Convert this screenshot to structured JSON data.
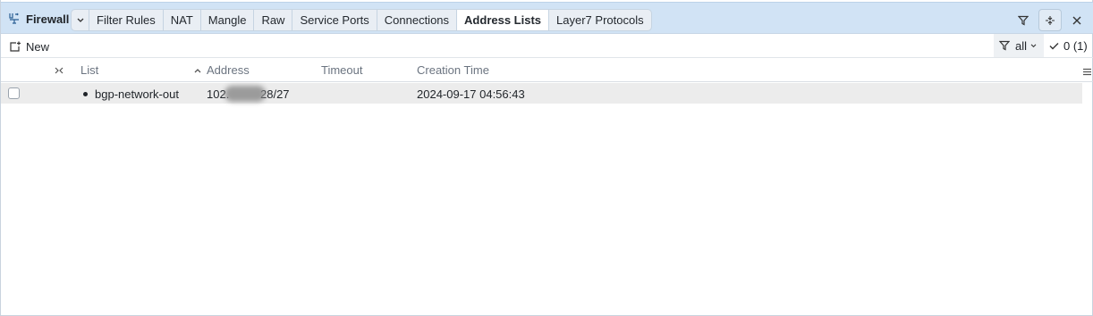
{
  "window": {
    "title": "Firewall",
    "icon": "firewall-network-icon"
  },
  "tabs": [
    {
      "label": "Filter Rules",
      "active": false
    },
    {
      "label": "NAT",
      "active": false
    },
    {
      "label": "Mangle",
      "active": false
    },
    {
      "label": "Raw",
      "active": false
    },
    {
      "label": "Service Ports",
      "active": false
    },
    {
      "label": "Connections",
      "active": false
    },
    {
      "label": "Address Lists",
      "active": true
    },
    {
      "label": "Layer7 Protocols",
      "active": false
    }
  ],
  "toolbar": {
    "new_label": "New",
    "filter_value": "all",
    "selection_count": "0 (1)"
  },
  "table": {
    "columns": [
      "List",
      "Address",
      "Timeout",
      "Creation Time"
    ],
    "sort_column": "Address",
    "rows": [
      {
        "list": "bgp-network-out",
        "address_prefix": "102.",
        "address_suffix": "28/27",
        "timeout": "",
        "creation_time": "2024-09-17 04:56:43"
      }
    ]
  },
  "colors": {
    "titlebar_bg": "#d1e3f5",
    "active_tab_bg": "#ffffff",
    "row_bg": "#ececec"
  }
}
